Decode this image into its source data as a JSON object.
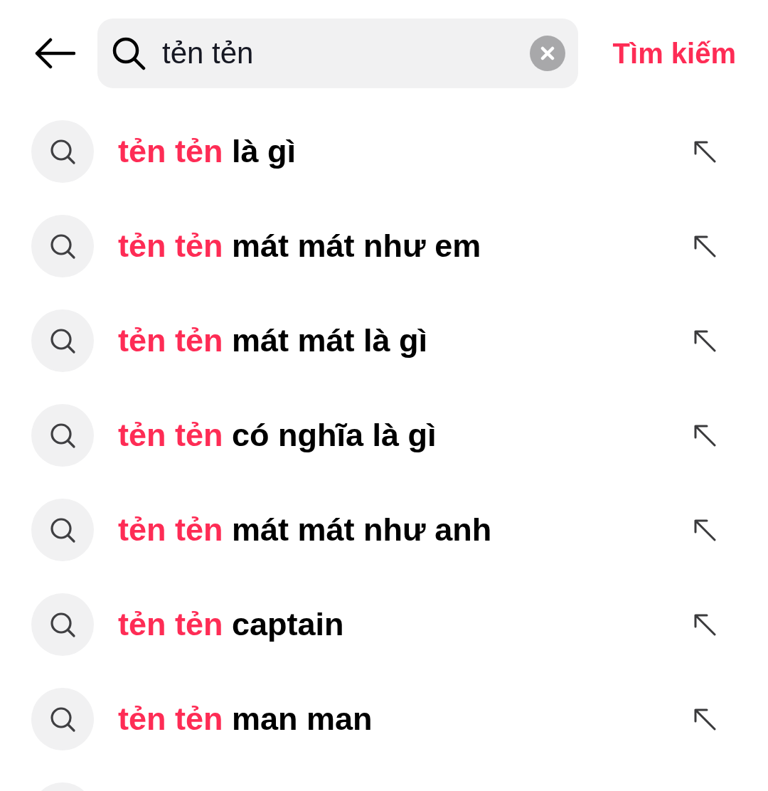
{
  "header": {
    "search_field": {
      "value": "tẻn tẻn"
    },
    "search_button": "Tìm kiếm"
  },
  "suggestions": [
    {
      "kind": "suggestion",
      "match": "tẻn tẻn",
      "rest": "là gì"
    },
    {
      "kind": "suggestion",
      "match": "tẻn tẻn",
      "rest": "mát mát như em"
    },
    {
      "kind": "suggestion",
      "match": "tẻn tẻn",
      "rest": "mát mát là gì"
    },
    {
      "kind": "suggestion",
      "match": "tẻn tẻn",
      "rest": "có nghĩa là gì"
    },
    {
      "kind": "suggestion",
      "match": "tẻn tẻn",
      "rest": "mát mát như anh"
    },
    {
      "kind": "suggestion",
      "match": "tẻn tẻn",
      "rest": "captain"
    },
    {
      "kind": "suggestion",
      "match": "tẻn tẻn",
      "rest": "man man"
    },
    {
      "kind": "cut_off"
    }
  ]
}
